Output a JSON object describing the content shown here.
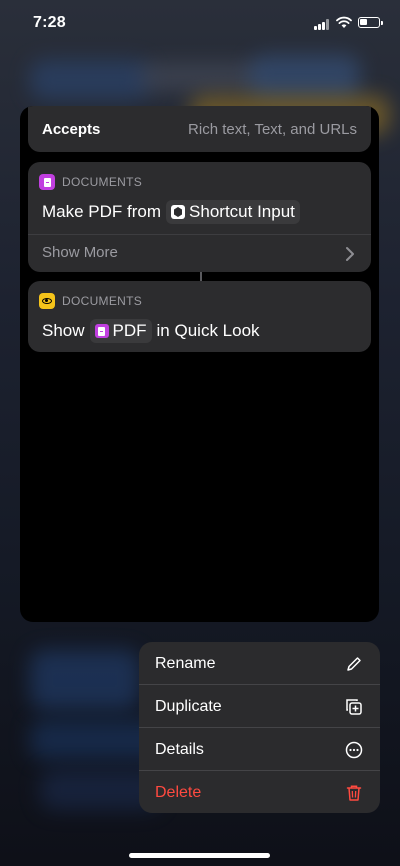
{
  "status_bar": {
    "time": "7:28"
  },
  "accepts": {
    "label": "Accepts",
    "value": "Rich text, Text, and URLs"
  },
  "actions": [
    {
      "category": "DOCUMENTS",
      "category_color": "#c13fe0",
      "text_before": "Make PDF from",
      "token": "Shortcut Input",
      "text_after": "",
      "show_more": "Show More"
    },
    {
      "category": "DOCUMENTS",
      "category_color": "#f6c41a",
      "text_before": "Show",
      "token": "PDF",
      "text_after": "in Quick Look"
    }
  ],
  "context_menu": {
    "items": [
      {
        "label": "Rename",
        "icon": "pencil-icon"
      },
      {
        "label": "Duplicate",
        "icon": "duplicate-icon"
      },
      {
        "label": "Details",
        "icon": "ellipsis-circle-icon"
      },
      {
        "label": "Delete",
        "icon": "trash-icon",
        "color": "#ff4a40"
      }
    ]
  }
}
